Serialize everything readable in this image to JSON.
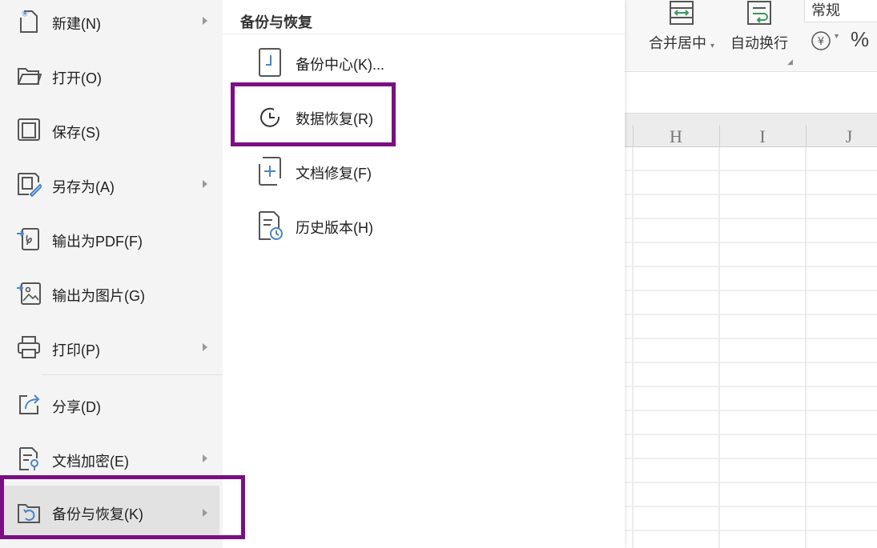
{
  "left_menu": {
    "items": [
      {
        "label": "新建(N)",
        "icon": "new-file-icon",
        "has_submenu": true
      },
      {
        "label": "打开(O)",
        "icon": "folder-open-icon",
        "has_submenu": false
      },
      {
        "label": "保存(S)",
        "icon": "save-icon",
        "has_submenu": false
      },
      {
        "label": "另存为(A)",
        "icon": "save-as-icon",
        "has_submenu": true
      },
      {
        "label": "输出为PDF(F)",
        "icon": "export-pdf-icon",
        "has_submenu": false
      },
      {
        "label": "输出为图片(G)",
        "icon": "export-image-icon",
        "has_submenu": false
      },
      {
        "label": "打印(P)",
        "icon": "printer-icon",
        "has_submenu": true
      },
      {
        "label": "分享(D)",
        "icon": "share-icon",
        "has_submenu": false
      },
      {
        "label": "文档加密(E)",
        "icon": "encrypt-document-icon",
        "has_submenu": true
      },
      {
        "label": "备份与恢复(K)",
        "icon": "backup-restore-icon",
        "has_submenu": true,
        "active": true
      }
    ]
  },
  "submenu": {
    "title": "备份与恢复",
    "items": [
      {
        "label": "备份中心(K)...",
        "icon": "backup-center-icon"
      },
      {
        "label": "数据恢复(R)",
        "icon": "data-recovery-icon",
        "highlighted": true
      },
      {
        "label": "文档修复(F)",
        "icon": "document-repair-icon"
      },
      {
        "label": "历史版本(H)",
        "icon": "history-version-icon"
      }
    ]
  },
  "ribbon": {
    "merge_center_label": "合并居中",
    "wrap_text_label": "自动换行",
    "number_format_value": "常规",
    "percent_symbol": "%"
  },
  "sheet": {
    "columns": [
      "H",
      "I",
      "J"
    ]
  },
  "colors": {
    "highlight": "#7a0f82",
    "accent_green": "#3a9b5c",
    "icon_blue": "#4a84c9",
    "menu_bg": "#f4f4f4"
  }
}
